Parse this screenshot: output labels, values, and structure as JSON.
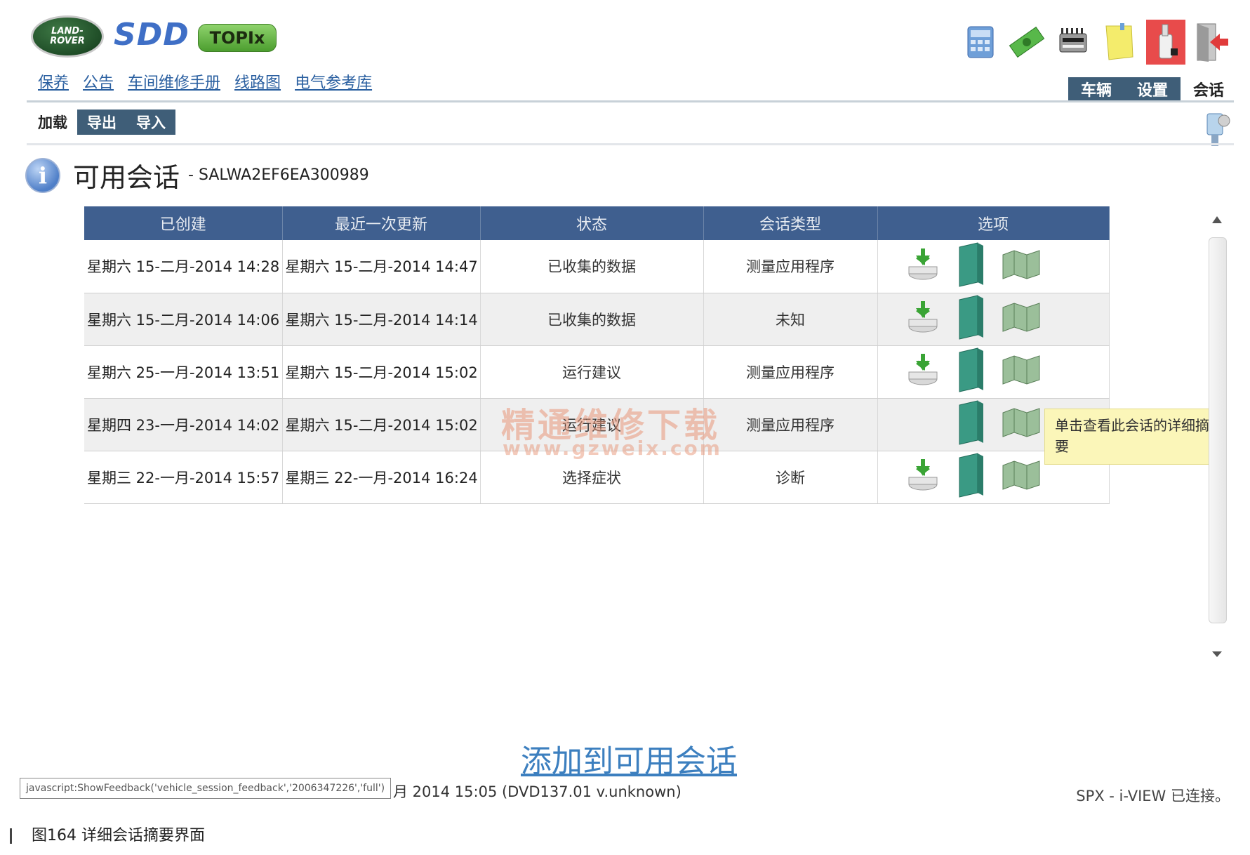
{
  "brand": {
    "lr_line1": "LAND-",
    "lr_line2": "ROVER",
    "sdd": "SDD",
    "topix": "TOPIx"
  },
  "toplinks": [
    "保养",
    "公告",
    "车间维修手册",
    "线路图",
    "电气参考库"
  ],
  "right_tabs": [
    {
      "label": "车辆",
      "active": false
    },
    {
      "label": "设置",
      "active": false
    },
    {
      "label": "会话",
      "active": true
    }
  ],
  "sub_tabs": [
    {
      "label": "加载",
      "active": true
    },
    {
      "label": "导出",
      "active": false
    },
    {
      "label": "导入",
      "active": false
    }
  ],
  "title": {
    "main": "可用会话",
    "vin": "- SALWA2EF6EA300989"
  },
  "table": {
    "headers": [
      "已创建",
      "最近一次更新",
      "状态",
      "会话类型",
      "选项"
    ],
    "rows": [
      {
        "created": "星期六 15-二月-2014 14:28",
        "updated": "星期六 15-二月-2014 14:47",
        "status": "已收集的数据",
        "type": "测量应用程序",
        "load": true
      },
      {
        "created": "星期六 15-二月-2014 14:06",
        "updated": "星期六 15-二月-2014 14:14",
        "status": "已收集的数据",
        "type": "未知",
        "load": true
      },
      {
        "created": "星期六 25-一月-2014 13:51",
        "updated": "星期六 15-二月-2014 15:02",
        "status": "运行建议",
        "type": "测量应用程序",
        "load": true
      },
      {
        "created": "星期四 23-一月-2014 14:02",
        "updated": "星期六 15-二月-2014 15:02",
        "status": "运行建议",
        "type": "测量应用程序",
        "load": false
      },
      {
        "created": "星期三 22-一月-2014 15:57",
        "updated": "星期三 22-一月-2014 16:24",
        "status": "选择症状",
        "type": "诊断",
        "load": true
      }
    ]
  },
  "tooltip": {
    "text": "单击查看此会话的详细摘要"
  },
  "watermark": {
    "text": "精通维修下载",
    "url": "www.gzweix.com"
  },
  "footer": {
    "add_session": "添加到可用会话",
    "js_link": "javascript:ShowFeedback('vehicle_session_feedback','2006347226','full')",
    "status": "月 2014 15:05 (DVD137.01 v.unknown)",
    "connection": "SPX - i-VIEW 已连接。"
  },
  "caption": "图164   详细会话摘要界面",
  "colors": {
    "header_blue": "#3f5f8f",
    "tab_blue": "#3f5e78",
    "link_blue": "#2a5fa0",
    "tooltip_yellow": "#fbf6b9"
  }
}
